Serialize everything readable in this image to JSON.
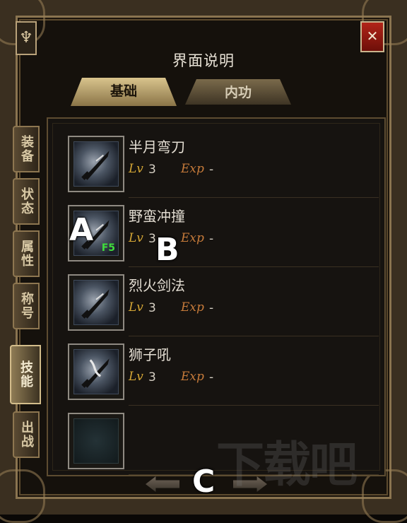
{
  "window": {
    "title": "界面说明",
    "close_icon": "close-icon",
    "emblem_glyph": "♆"
  },
  "tabs": [
    {
      "label": "基础",
      "active": true
    },
    {
      "label": "内功",
      "active": false
    }
  ],
  "side_tabs": [
    {
      "label": "装备",
      "active": false
    },
    {
      "label": "状态",
      "active": false
    },
    {
      "label": "属性",
      "active": false
    },
    {
      "label": "称号",
      "active": false
    },
    {
      "label": "技能",
      "active": true
    },
    {
      "label": "出战",
      "active": false
    }
  ],
  "labels": {
    "lv": "Lv",
    "exp": "Exp"
  },
  "skills": [
    {
      "name": "半月弯刀",
      "level": "3",
      "exp": "-",
      "hotkey": "",
      "icon": "sword-icon"
    },
    {
      "name": "野蛮冲撞",
      "level": "3",
      "exp": "-",
      "hotkey": "F5",
      "icon": "sword-icon"
    },
    {
      "name": "烈火剑法",
      "level": "3",
      "exp": "-",
      "hotkey": "",
      "icon": "sword-icon"
    },
    {
      "name": "狮子吼",
      "level": "3",
      "exp": "-",
      "hotkey": "",
      "icon": "sword-icon"
    },
    {
      "name": "",
      "level": "",
      "exp": "",
      "hotkey": "",
      "icon": "empty-slot-icon"
    }
  ],
  "markers": {
    "a": "A",
    "b": "B",
    "c": "C"
  },
  "watermark": "下载吧",
  "colors": {
    "frame": "#3a2f20",
    "gold": "#d4a635",
    "hotkey": "#3fdc3c",
    "close": "#b12418"
  }
}
